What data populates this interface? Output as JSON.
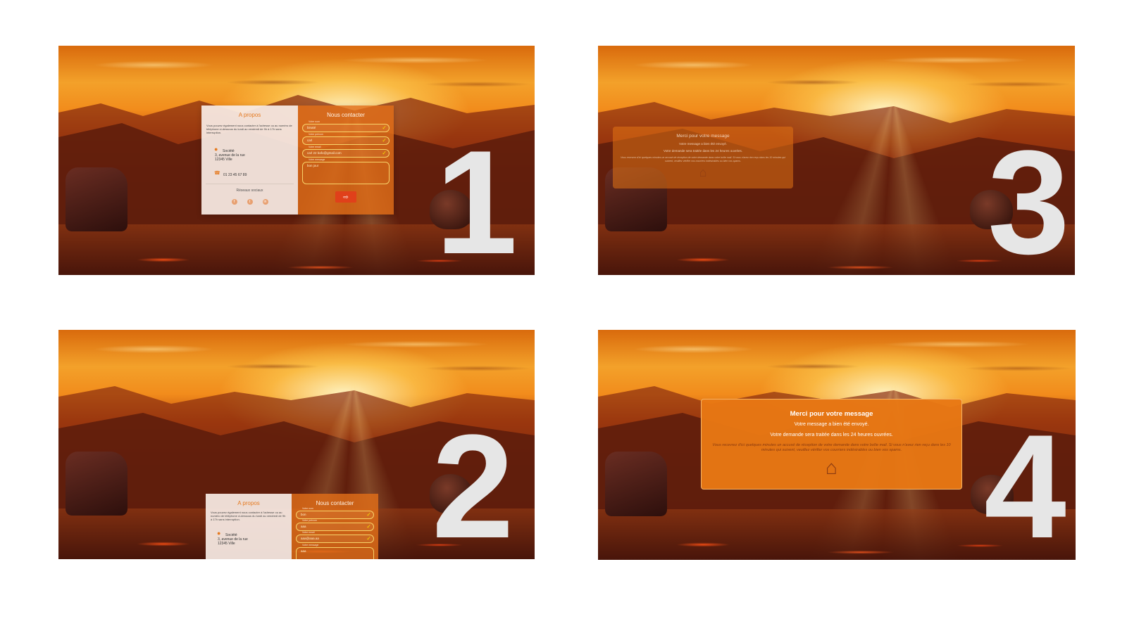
{
  "steps": [
    {
      "number": "1"
    },
    {
      "number": "2"
    },
    {
      "number": "3"
    },
    {
      "number": "4"
    }
  ],
  "about": {
    "title": "A propos",
    "text": "Vous pouvez également nous contacter à l'adresse ou au numéro de téléphone ci-dessous du lundi au vendredi de 9h à 17h sans interruption.",
    "company": "Société",
    "street": "3, avenue de la rue",
    "city": "12345 Ville",
    "phone": "01 23 45 67 89",
    "social_title": "Réseaux sociaux",
    "social_icons": [
      "facebook-icon",
      "twitter-icon",
      "linkedin-icon"
    ]
  },
  "contact": {
    "title": "Nous contacter",
    "fields": [
      {
        "label": "Votre nom",
        "value": "binaté"
      },
      {
        "label": "Votre prénom",
        "value": "carl"
      },
      {
        "label": "Votre email",
        "value": "carl 22 bafo@gmail.com"
      },
      {
        "label": "Votre message",
        "value": "bon jour"
      }
    ],
    "send_icon": "sign-out-icon"
  },
  "contact_step2": {
    "fields": [
      {
        "label": "Votre nom",
        "value": "bon"
      },
      {
        "label": "Votre prénom",
        "value": "aaa"
      },
      {
        "label": "Votre email",
        "value": "aaa@aaa.aa"
      },
      {
        "label": "Votre message",
        "value": "aaa"
      }
    ]
  },
  "confirmation": {
    "title": "Merci pour votre message",
    "sent": "Votre message a bien été envoyé.",
    "delay": "Votre demande sera traitée dans les 24 heures ouvrées.",
    "note": "Vous recevrez d'ici quelques minutes un accusé de réception de votre demande dans votre boîte mail. Si vous n'avez rien reçu dans les 10 minutes qui suivent, veuillez vérifier vos courriers indésirables ou bien vos spams.",
    "home_icon": "home-icon"
  },
  "colors": {
    "accent": "#e57a20",
    "card_orange": "#e8781a",
    "send_button": "#e0401a",
    "check": "#f6e000",
    "step_number": "#e6e6e6"
  }
}
